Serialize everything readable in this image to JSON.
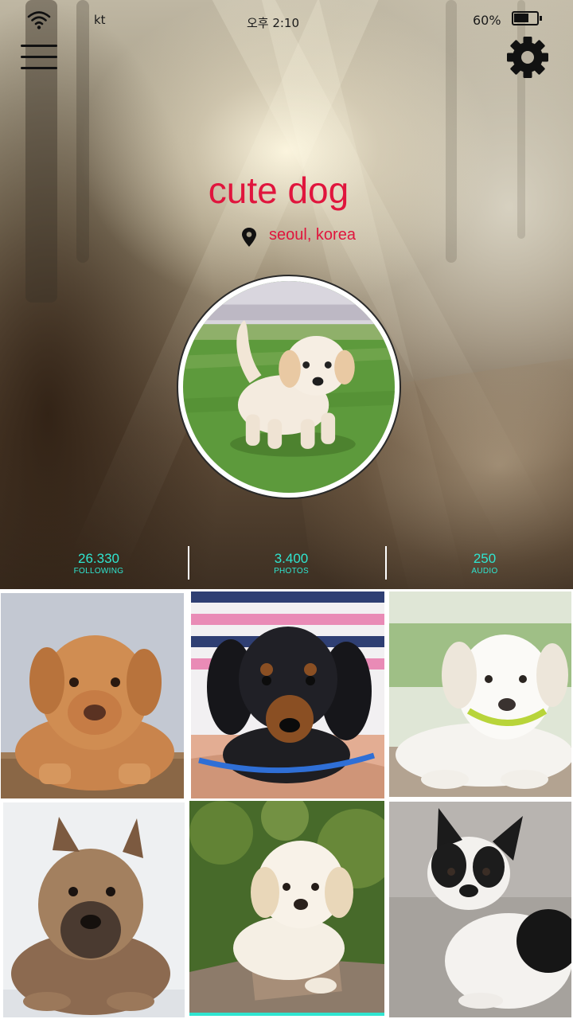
{
  "status_bar": {
    "carrier": "kt",
    "time": "오후 2:10",
    "battery_percent": "60%",
    "battery_level": 0.6
  },
  "toolbar": {
    "menu_icon": "hamburger-menu-icon",
    "settings_icon": "gear-icon"
  },
  "profile": {
    "name": "cute dog",
    "location": "seoul, korea",
    "location_icon": "map-pin-icon"
  },
  "stats": [
    {
      "value": "26.330",
      "label": "FOLLOWING"
    },
    {
      "value": "3.400",
      "label": "PHOTOS"
    },
    {
      "value": "250",
      "label": "AUDIO"
    }
  ],
  "colors": {
    "accent_red": "#e0153d",
    "stat_cyan": "#2fe5d0"
  },
  "photos": [
    {
      "subject": "dogue-de-bordeaux-puppy"
    },
    {
      "subject": "black-and-tan-dachshund-puppy"
    },
    {
      "subject": "white-labrador-puppy"
    },
    {
      "subject": "shiba-inu-puppy"
    },
    {
      "subject": "cream-maltipoo-puppy"
    },
    {
      "subject": "french-bulldog-puppy"
    }
  ]
}
